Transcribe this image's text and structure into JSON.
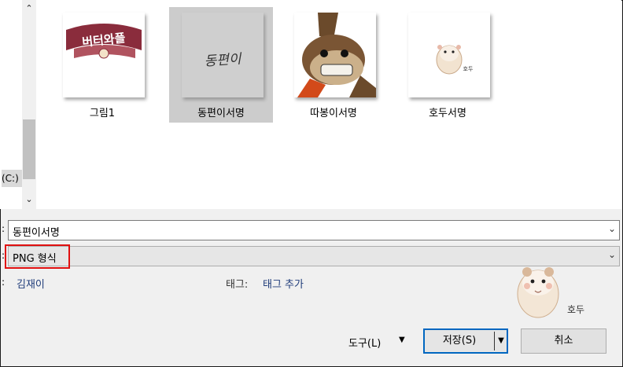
{
  "nav": {
    "drive_label": "(C:)"
  },
  "scroll": {
    "up_icon": "chevron-up-icon",
    "down_icon": "chevron-down-icon"
  },
  "files": [
    {
      "label": "그림1",
      "logo_text": "버터와플",
      "selected": false
    },
    {
      "label": "동편이서명",
      "signature_text": "동편이",
      "selected": true
    },
    {
      "label": "따봉이서명",
      "selected": false
    },
    {
      "label": "호두서명",
      "signature_text": "호두",
      "selected": false
    }
  ],
  "form": {
    "filename_label": ":",
    "filename_value": "동편이서명",
    "filetype_label": ":",
    "filetype_value": "PNG 형식",
    "author_label": ":",
    "author_value": "김재이",
    "tags_label": "태그:",
    "tags_value": "태그 추가"
  },
  "buttons": {
    "tools_label": "도구(L)",
    "save_label": "저장(S)",
    "cancel_label": "취소"
  },
  "decor": {
    "corner_signature": "호두"
  },
  "colors": {
    "selection": "#cccccc",
    "highlight_border": "#e01010",
    "save_border": "#0067c0",
    "link": "#1f3c7a"
  }
}
